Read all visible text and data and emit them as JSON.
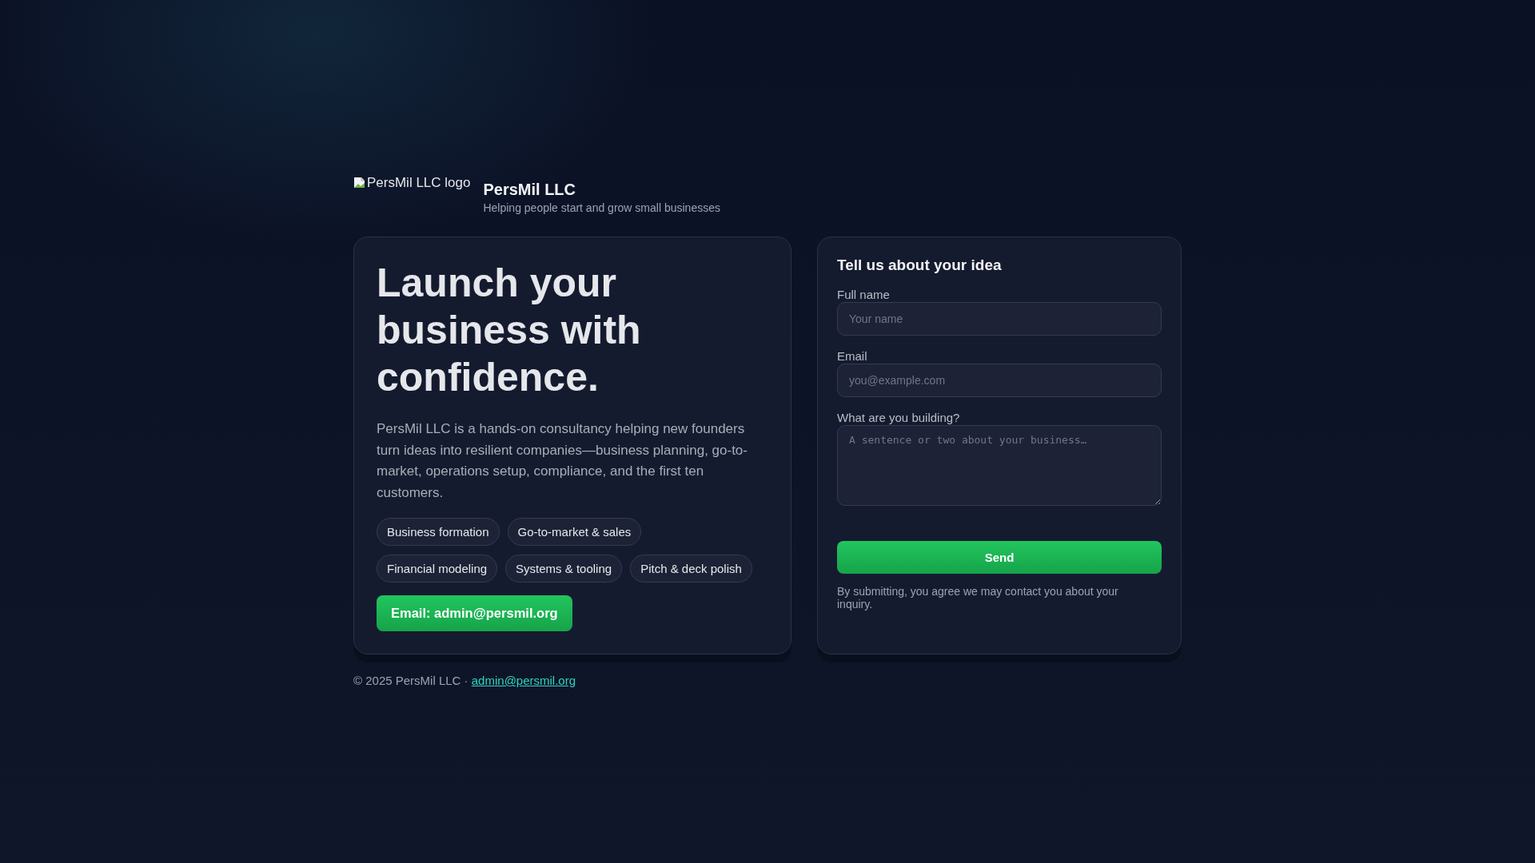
{
  "header": {
    "logo_alt": "PersMil LLC logo",
    "brand": "PersMil LLC",
    "tagline": "Helping people start and grow small businesses"
  },
  "hero": {
    "headline": "Launch your business with confidence.",
    "description": "PersMil LLC is a hands-on consultancy helping new founders turn ideas into resilient companies—business planning, go-to-market, operations setup, compliance, and the first ten customers.",
    "tags": [
      "Business formation",
      "Go-to-market & sales",
      "Financial modeling",
      "Systems & tooling",
      "Pitch & deck polish"
    ],
    "email_button": "Email: admin@persmil.org"
  },
  "form": {
    "title": "Tell us about your idea",
    "fields": [
      {
        "label": "Full name",
        "placeholder": "Your name",
        "kind": "text"
      },
      {
        "label": "Email",
        "placeholder": "you@example.com",
        "kind": "email"
      },
      {
        "label": "What are you building?",
        "placeholder": "A sentence or two about your business…",
        "kind": "textarea"
      }
    ],
    "submit": "Send",
    "note": "By submitting, you agree we may contact you about your inquiry."
  },
  "footer": {
    "text": "© 2025 PersMil LLC ·",
    "link": "admin@persmil.org"
  }
}
